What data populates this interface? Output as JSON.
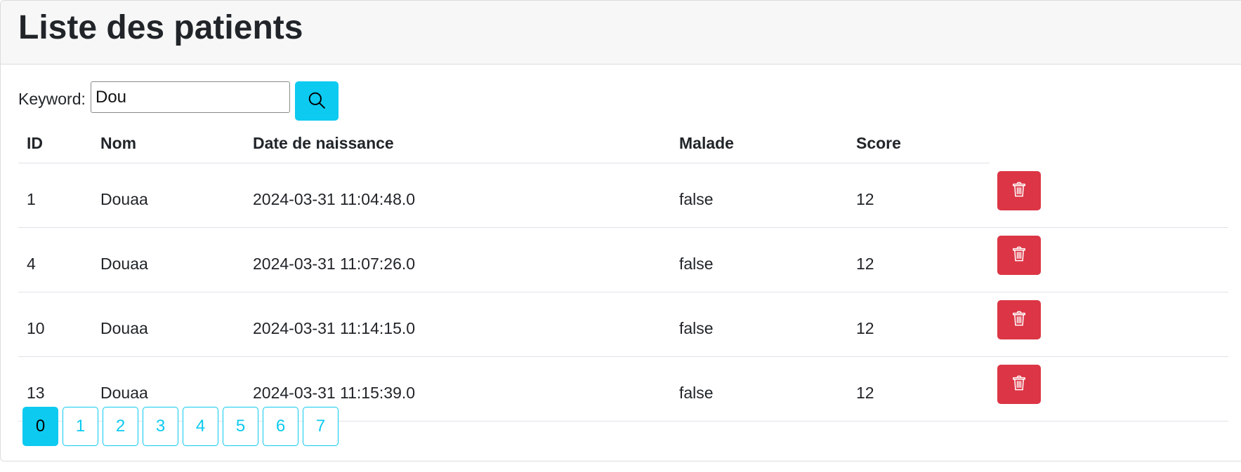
{
  "header": {
    "title": "Liste des patients"
  },
  "search": {
    "label": "Keyword:",
    "value": "Dou",
    "button_icon": "search-icon"
  },
  "table": {
    "columns": [
      "ID",
      "Nom",
      "Date de naissance",
      "Malade",
      "Score"
    ],
    "rows": [
      {
        "id": "1",
        "nom": "Douaa",
        "date": "2024-03-31 11:04:48.0",
        "malade": "false",
        "score": "12"
      },
      {
        "id": "4",
        "nom": "Douaa",
        "date": "2024-03-31 11:07:26.0",
        "malade": "false",
        "score": "12"
      },
      {
        "id": "10",
        "nom": "Douaa",
        "date": "2024-03-31 11:14:15.0",
        "malade": "false",
        "score": "12"
      },
      {
        "id": "13",
        "nom": "Douaa",
        "date": "2024-03-31 11:15:39.0",
        "malade": "false",
        "score": "12"
      }
    ],
    "row_action_icon": "trash-icon"
  },
  "pagination": {
    "pages": [
      "0",
      "1",
      "2",
      "3",
      "4",
      "5",
      "6",
      "7"
    ],
    "current": "0"
  },
  "colors": {
    "info": "#0dcaf0",
    "danger": "#dc3545",
    "header_bg": "#f7f7f7"
  }
}
